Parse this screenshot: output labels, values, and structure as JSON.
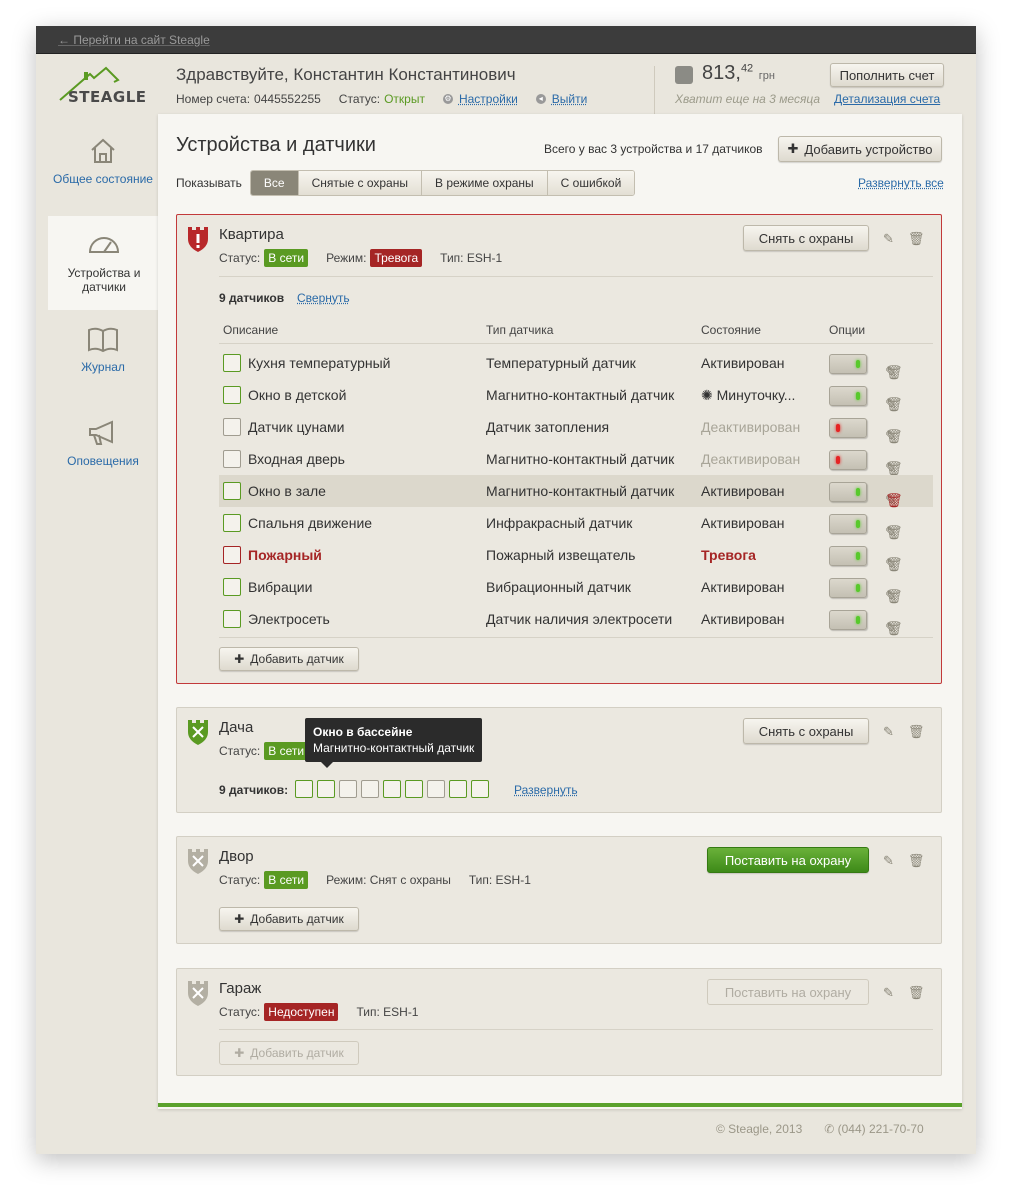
{
  "topbar": {
    "back_link": "← Перейти на сайт Steagle"
  },
  "logo": {
    "text": "STEAGLE"
  },
  "header": {
    "greeting": "Здравствуйте, Константин Константинович",
    "account_label": "Номер счета:",
    "account_number": "0445552255",
    "status_label": "Статус:",
    "status_value": "Открыт",
    "settings_link": "Настройки",
    "logout_link": "Выйти",
    "balance_main": "813,",
    "balance_cents": "42",
    "balance_currency": "грн",
    "topup_button": "Пополнить счет",
    "balance_hint": "Хватит еще на 3 месяца",
    "details_link": "Детализация счета"
  },
  "sidebar": {
    "items": [
      {
        "label": "Общее состояние",
        "icon": "home-icon"
      },
      {
        "label": "Устройства и датчики",
        "icon": "gauge-icon"
      },
      {
        "label": "Журнал",
        "icon": "book-icon"
      },
      {
        "label": "Оповещения",
        "icon": "megaphone-icon"
      }
    ]
  },
  "main": {
    "title": "Устройства и датчики",
    "totals": "Всего у вас 3 устройства и 17 датчиков",
    "add_device": "Добавить устройство",
    "show_label": "Показывать",
    "filters": [
      "Все",
      "Снятые с охраны",
      "В режиме охраны",
      "С ошибкой"
    ],
    "expand_all": "Развернуть все"
  },
  "labels": {
    "status": "Статус:",
    "mode": "Режим:",
    "type": "Тип: ESH-1",
    "add_sensor": "Добавить датчик",
    "disarm": "Снять с охраны",
    "arm": "Поставить на охрану"
  },
  "devices": [
    {
      "name": "Квартира",
      "status": "В сети",
      "mode": "Тревога",
      "sensors_count": "9 датчиков",
      "collapse": "Свернуть",
      "columns": [
        "Описание",
        "Тип датчика",
        "Состояние",
        "Опции"
      ],
      "sensors": [
        {
          "name": "Кухня температурный",
          "type": "Температурный датчик",
          "state": "Активирован",
          "on": true
        },
        {
          "name": "Окно в детской",
          "type": "Магнитно-контактный датчик",
          "state": "Минуточку...",
          "on": true
        },
        {
          "name": "Датчик цунами",
          "type": "Датчик затопления",
          "state": "Деактивирован",
          "on": false
        },
        {
          "name": "Входная дверь",
          "type": "Магнитно-контактный датчик",
          "state": "Деактивирован",
          "on": false
        },
        {
          "name": "Окно в зале",
          "type": "Магнитно-контактный датчик",
          "state": "Активирован",
          "on": true
        },
        {
          "name": "Спальня движение",
          "type": "Инфракрасный датчик",
          "state": "Активирован",
          "on": true
        },
        {
          "name": "Пожарный",
          "type": "Пожарный извещатель",
          "state": "Тревога",
          "on": true
        },
        {
          "name": "Вибрации",
          "type": "Вибрационный датчик",
          "state": "Активирован",
          "on": true
        },
        {
          "name": "Электросеть",
          "type": "Датчик наличия электросети",
          "state": "Активирован",
          "on": true
        }
      ]
    },
    {
      "name": "Дача",
      "status": "В сети",
      "sensors_count": "9 датчиков:",
      "expand": "Развернуть",
      "tooltip_title": "Окно в бассейне",
      "tooltip_text": "Магнитно-контактный датчик"
    },
    {
      "name": "Двор",
      "status": "В сети",
      "mode_text": "Режим: Снят с охраны"
    },
    {
      "name": "Гараж",
      "status": "Недоступен"
    }
  ],
  "footer": {
    "copyright": "© Steagle, 2013",
    "phone": "(044) 221-70-70"
  },
  "colors": {
    "accent_green": "#5a9a22",
    "alarm_red": "#a52525",
    "link_blue": "#2a6aa8"
  }
}
